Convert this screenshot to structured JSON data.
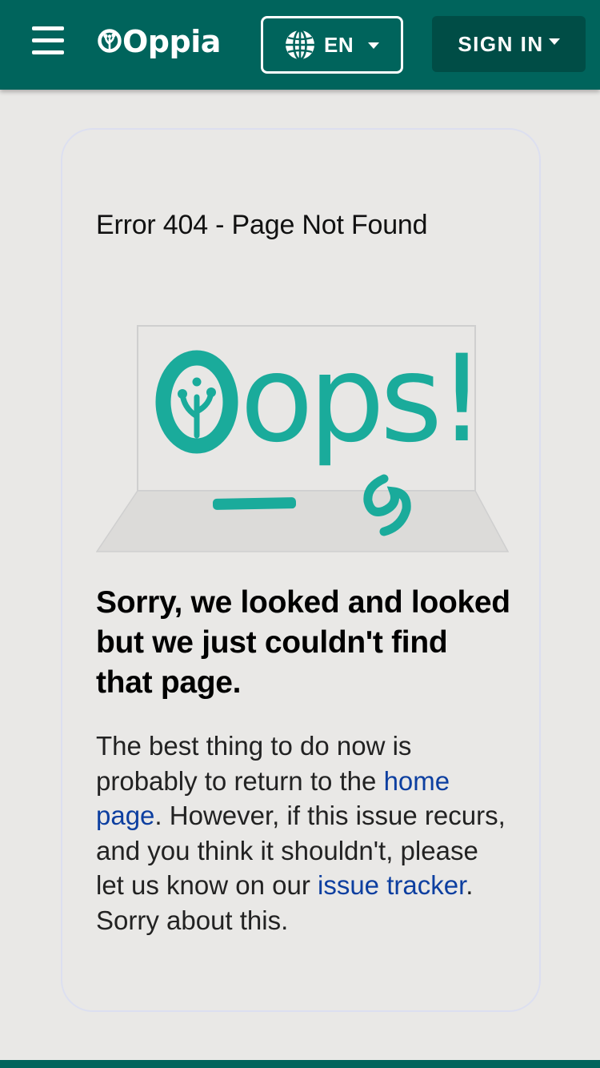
{
  "header": {
    "menu_icon": "hamburger-menu-icon",
    "logo_text": "Oppia",
    "language": {
      "icon": "globe-icon",
      "label": "EN"
    },
    "sign_in_label": "SIGN IN"
  },
  "error_page": {
    "title": "Error 404 - Page Not Found",
    "image_text": "Oops!",
    "heading": "Sorry, we looked and looked but we just couldn't find that page.",
    "message": {
      "part1": "The best thing to do now is probably to return to the ",
      "home_link": "home page",
      "part2": ". However, if this issue recurs, and you think it shouldn't, please let us know on our ",
      "tracker_link": "issue tracker",
      "part3": ". Sorry about this."
    }
  },
  "colors": {
    "navbar": "#00645c",
    "sign_in_button": "#004d46",
    "page_background": "#e9e8e6",
    "oops_teal": "#1aab9b",
    "link": "#0d3fa0"
  }
}
